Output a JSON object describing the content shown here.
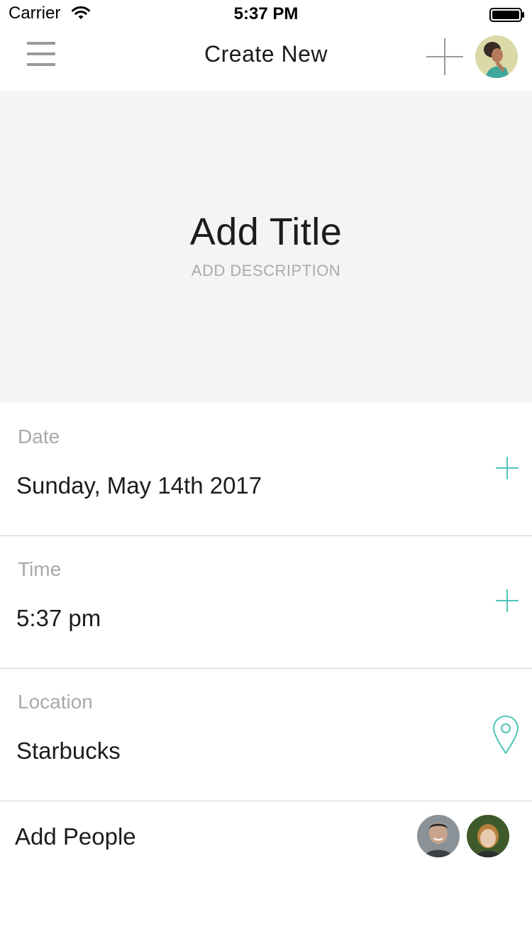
{
  "status_bar": {
    "carrier": "Carrier",
    "time": "5:37 PM"
  },
  "nav": {
    "title": "Create New",
    "menu_icon": "hamburger-menu-icon",
    "add_icon": "plus-icon",
    "avatar_icon": "user-avatar"
  },
  "hero": {
    "title": "Add Title",
    "description": "ADD DESCRIPTION"
  },
  "fields": {
    "date": {
      "label": "Date",
      "value": "Sunday, May 14th 2017",
      "icon": "plus-icon"
    },
    "time": {
      "label": "Time",
      "value": "5:37 pm",
      "icon": "plus-icon"
    },
    "location": {
      "label": "Location",
      "value": "Starbucks",
      "icon": "map-pin-icon"
    }
  },
  "people": {
    "label": "Add People",
    "avatars": [
      "person-avatar-1",
      "person-avatar-2"
    ]
  },
  "colors": {
    "accent": "#4ec5b5",
    "hero_bg": "#f4f4f4",
    "label_gray": "#a9a9a9",
    "divider": "#cfcfcf"
  }
}
